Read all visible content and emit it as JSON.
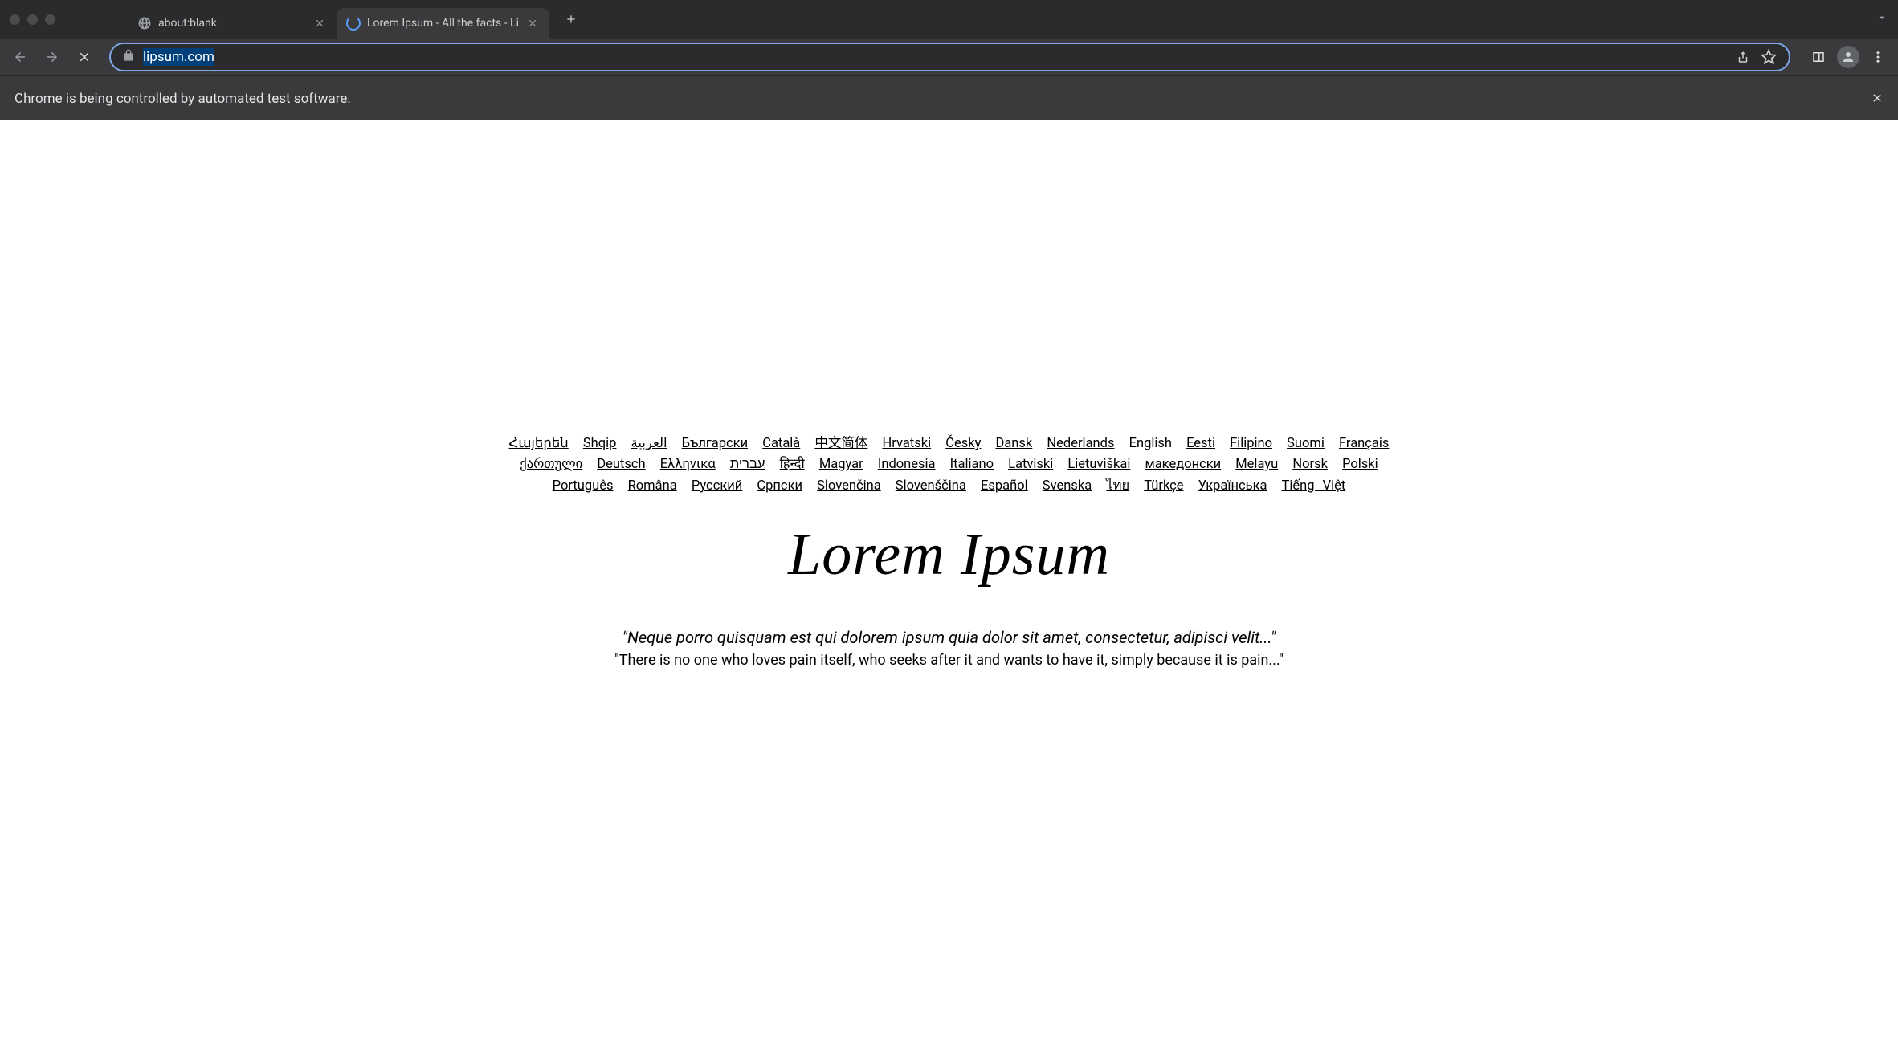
{
  "browser": {
    "tabs": [
      {
        "title": "about:blank",
        "active": false,
        "favicon": "globe"
      },
      {
        "title": "Lorem Ipsum - All the facts - Li",
        "active": true,
        "favicon": "loading"
      }
    ],
    "url": "lipsum.com",
    "info_bar": "Chrome is being controlled by automated test software."
  },
  "page": {
    "languages": [
      "Հայերեն",
      "Shqip",
      "العربية",
      "Български",
      "Català",
      "中文简体",
      "Hrvatski",
      "Česky",
      "Dansk",
      "Nederlands",
      "English",
      "Eesti",
      "Filipino",
      "Suomi",
      "Français",
      "ქართული",
      "Deutsch",
      "Ελληνικά",
      "עברית",
      "हिन्दी",
      "Magyar",
      "Indonesia",
      "Italiano",
      "Latviski",
      "Lietuviškai",
      "македонски",
      "Melayu",
      "Norsk",
      "Polski",
      "Português",
      "Româna",
      "Русский",
      "Српски",
      "Slovenčina",
      "Slovenščina",
      "Español",
      "Svenska",
      "ไทย",
      "Türkçe",
      "Українська",
      "Tiếng Việt"
    ],
    "current_language": "English",
    "title": "Lorem Ipsum",
    "quote_latin": "\"Neque porro quisquam est qui dolorem ipsum quia dolor sit amet, consectetur, adipisci velit...\"",
    "quote_english": "\"There is no one who loves pain itself, who seeks after it and wants to have it, simply because it is pain...\""
  }
}
